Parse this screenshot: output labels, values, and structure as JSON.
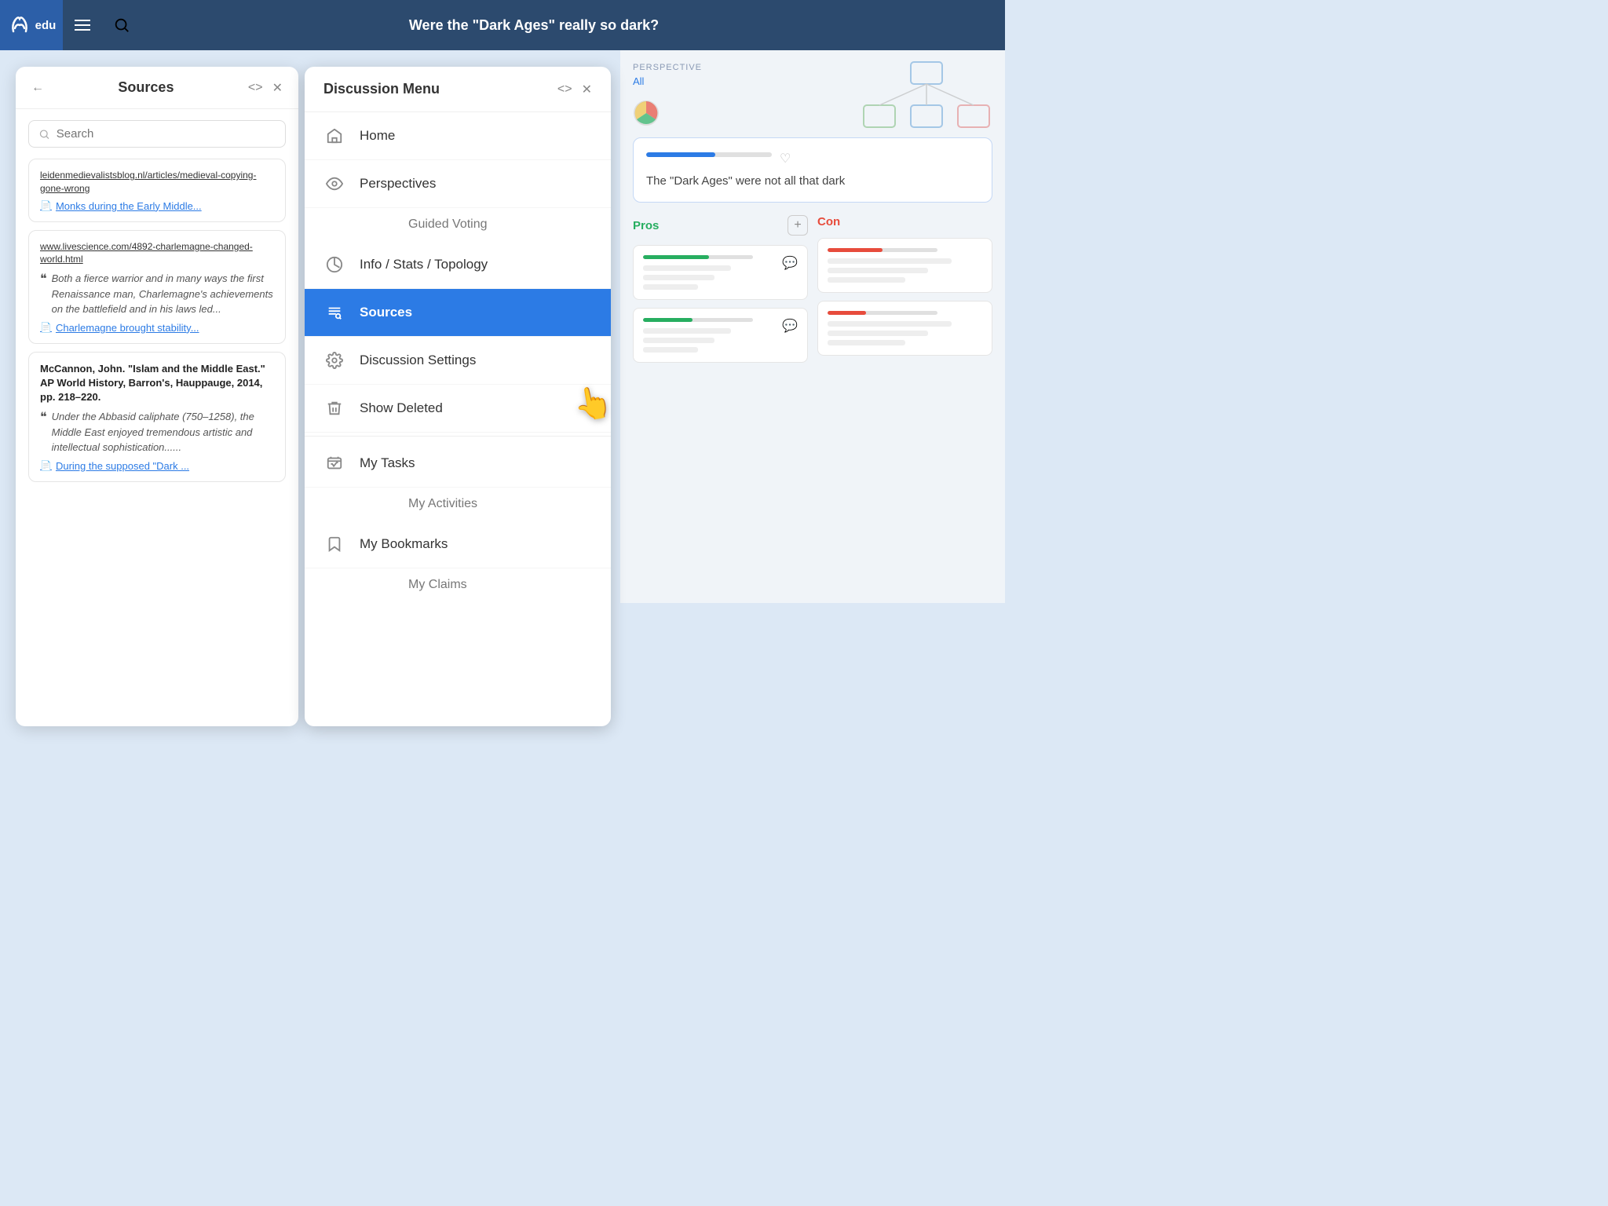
{
  "app": {
    "logo": "edu",
    "title": "Were the \"Dark Ages\" really so dark?"
  },
  "sources_panel": {
    "title": "Sources",
    "search_placeholder": "Search",
    "back_icon": "←",
    "code_icon": "<>",
    "close_icon": "✕",
    "sources": [
      {
        "url": "leidenmedievalistsblog.nl/articles/medieval-copying-gone-wrong",
        "link_text": "Monks during the Early Middle...",
        "link_icon": "📄"
      },
      {
        "url": "www.livescience.com/4892-charlemagne-changed-world.html",
        "quote": "Both a fierce warrior and in many ways the first Renaissance man, Charlemagne's achievements on the battlefield and in his laws led...",
        "quote_mark": "❝",
        "link_text": "Charlemagne brought stability...",
        "link_icon": "📄"
      },
      {
        "title": "McCannon, John. \"Islam and the Middle East.\" AP World History, Barron's, Hauppauge, 2014, pp. 218–220.",
        "quote": "Under the Abbasid caliphate (750–1258), the Middle East enjoyed tremendous artistic and intellectual sophistication......",
        "quote_mark": "❝",
        "link_text": "During the supposed \"Dark ...",
        "link_icon": "📄"
      }
    ]
  },
  "discussion_menu": {
    "title": "Discussion Menu",
    "code_icon": "<>",
    "close_icon": "✕",
    "items": [
      {
        "id": "home",
        "label": "Home",
        "icon": "home"
      },
      {
        "id": "perspectives",
        "label": "Perspectives",
        "icon": "eye"
      },
      {
        "id": "guided-voting",
        "label": "Guided Voting",
        "icon": null,
        "sub": true
      },
      {
        "id": "info-stats",
        "label": "Info / Stats / Topology",
        "icon": "chart"
      },
      {
        "id": "sources",
        "label": "Sources",
        "icon": "sources",
        "active": true
      },
      {
        "id": "discussion-settings",
        "label": "Discussion Settings",
        "icon": "gear"
      },
      {
        "id": "show-deleted",
        "label": "Show Deleted",
        "icon": "trash"
      },
      {
        "id": "my-tasks",
        "label": "My Tasks",
        "icon": "tasks"
      },
      {
        "id": "my-activities",
        "label": "My Activities",
        "icon": null,
        "sub": true
      },
      {
        "id": "my-bookmarks",
        "label": "My Bookmarks",
        "icon": "bookmark"
      },
      {
        "id": "my-claims",
        "label": "My Claims",
        "icon": null,
        "sub": true
      }
    ]
  },
  "discussion_view": {
    "perspective_label": "PERSPECTIVE",
    "perspective_value": "All",
    "claim_text": "The \"Dark Ages\" were not all that dark",
    "pros_label": "Pros",
    "cons_label": "Con",
    "add_btn": "+",
    "args": [
      {
        "type": "pro"
      },
      {
        "type": "pro"
      },
      {
        "type": "con"
      },
      {
        "type": "con"
      }
    ]
  }
}
